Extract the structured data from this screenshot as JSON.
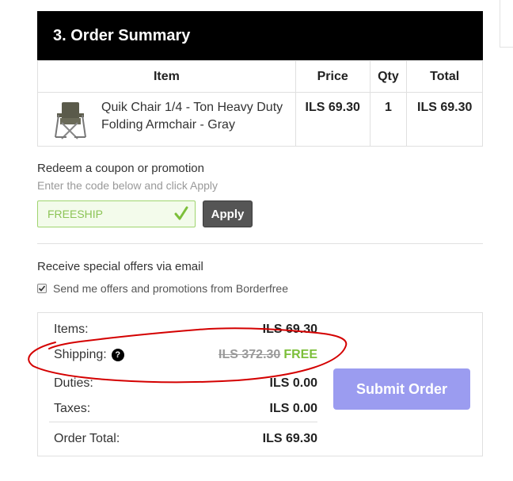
{
  "section": {
    "title": "3. Order Summary"
  },
  "table": {
    "headers": {
      "item": "Item",
      "price": "Price",
      "qty": "Qty",
      "total": "Total"
    },
    "rows": [
      {
        "name": "Quik Chair 1/4 - Ton Heavy Duty Folding Armchair - Gray",
        "price": "ILS 69.30",
        "qty": "1",
        "total": "ILS 69.30"
      }
    ]
  },
  "coupon": {
    "title": "Redeem a coupon or promotion",
    "hint": "Enter the code below and click Apply",
    "value": "FREESHIP",
    "apply_label": "Apply"
  },
  "offers": {
    "title": "Receive special offers via email",
    "checkbox_label": "Send me offers and promotions from Borderfree",
    "checked": true
  },
  "totals": {
    "items_label": "Items:",
    "items_value": "ILS 69.30",
    "shipping_label": "Shipping:",
    "shipping_help": "?",
    "shipping_original": "ILS 372.30",
    "shipping_value": "FREE",
    "duties_label": "Duties:",
    "duties_value": "ILS 0.00",
    "taxes_label": "Taxes:",
    "taxes_value": "ILS 0.00",
    "order_total_label": "Order Total:",
    "order_total_value": "ILS 69.30"
  },
  "submit": {
    "label": "Submit Order"
  },
  "colors": {
    "header_bg": "#000000",
    "free_green": "#7cbf3a",
    "submit_bg": "#9b9cf0",
    "annotation_red": "#d40000"
  }
}
